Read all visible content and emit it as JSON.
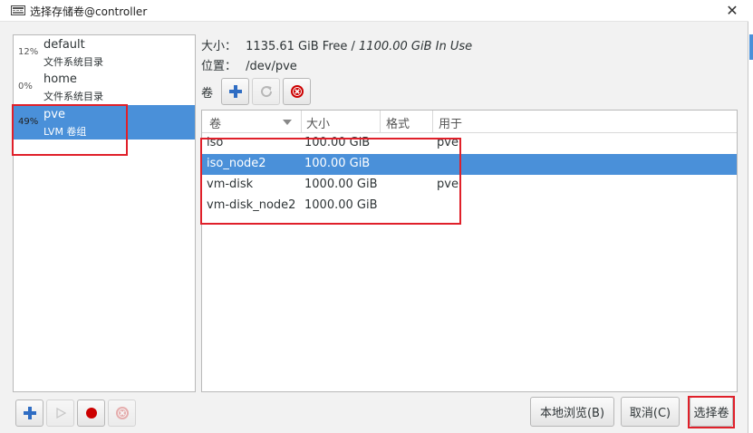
{
  "window": {
    "title": "选择存储卷@controller",
    "close_label": "✕"
  },
  "pools": [
    {
      "percent": "12%",
      "name": "default",
      "type": "文件系统目录"
    },
    {
      "percent": "0%",
      "name": "home",
      "type": "文件系统目录"
    },
    {
      "percent": "49%",
      "name": "pve",
      "type": "LVM 卷组",
      "selected": true
    }
  ],
  "info": {
    "size_label": "大小：",
    "size_free": "1135.61 GiB Free /",
    "size_used": "1100.00 GiB In Use",
    "location_label": "位置：",
    "location_value": "/dev/pve"
  },
  "volumes_toolbar": {
    "label": "卷",
    "add_icon": "plus-icon",
    "refresh_icon": "refresh-icon",
    "delete_icon": "delete-icon"
  },
  "volume_table": {
    "headers": [
      "卷",
      "大小",
      "格式",
      "用于"
    ],
    "rows": [
      {
        "name": "iso",
        "size": "100.00 GiB",
        "format": "",
        "used_by": "pve"
      },
      {
        "name": "iso_node2",
        "size": "100.00 GiB",
        "format": "",
        "used_by": "",
        "selected": true
      },
      {
        "name": "vm-disk",
        "size": "1000.00 GiB",
        "format": "",
        "used_by": "pve"
      },
      {
        "name": "vm-disk_node2",
        "size": "1000.00 GiB",
        "format": "",
        "used_by": ""
      }
    ]
  },
  "bottom": {
    "browse_label": "本地浏览(B)",
    "cancel_label": "取消(C)",
    "choose_label": "选择卷"
  },
  "colors": {
    "selection": "#4a90d9",
    "annotation": "#e0202a",
    "delete": "#cc0000"
  }
}
